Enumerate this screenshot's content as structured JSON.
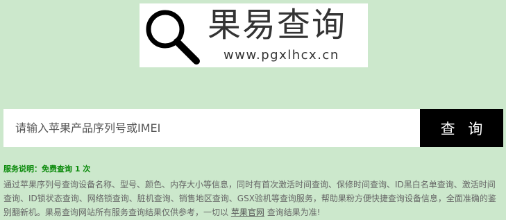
{
  "logo": {
    "brand": "果易查询",
    "url": "www.pgxlhcx.cn",
    "icon": "magnifier-icon"
  },
  "search": {
    "placeholder": "请输入苹果产品序列号或IMEI",
    "value": "",
    "button_label": "查 询"
  },
  "service": {
    "title": "服务说明：免费查询 1 次",
    "desc_part1": "通过苹果序列号查询设备名称、型号、颜色、内存大小等信息，同时有首次激活时间查询、保修时间查询、ID黑白名单查询、激活时间查询、ID锁状态查询、网络锁查询、脏机查询、销售地区查询、GSX验机等查询服务，帮助果粉方便快捷查询设备信息，全面准确的鉴别翻新机。果易查询网站所有服务查询结果仅供参考，一切以",
    "link_text": "苹果官网",
    "desc_part2": "查询结果为准!"
  },
  "colors": {
    "background": "#cce8cc",
    "service_title": "#0a8a0a",
    "button": "#000000"
  }
}
